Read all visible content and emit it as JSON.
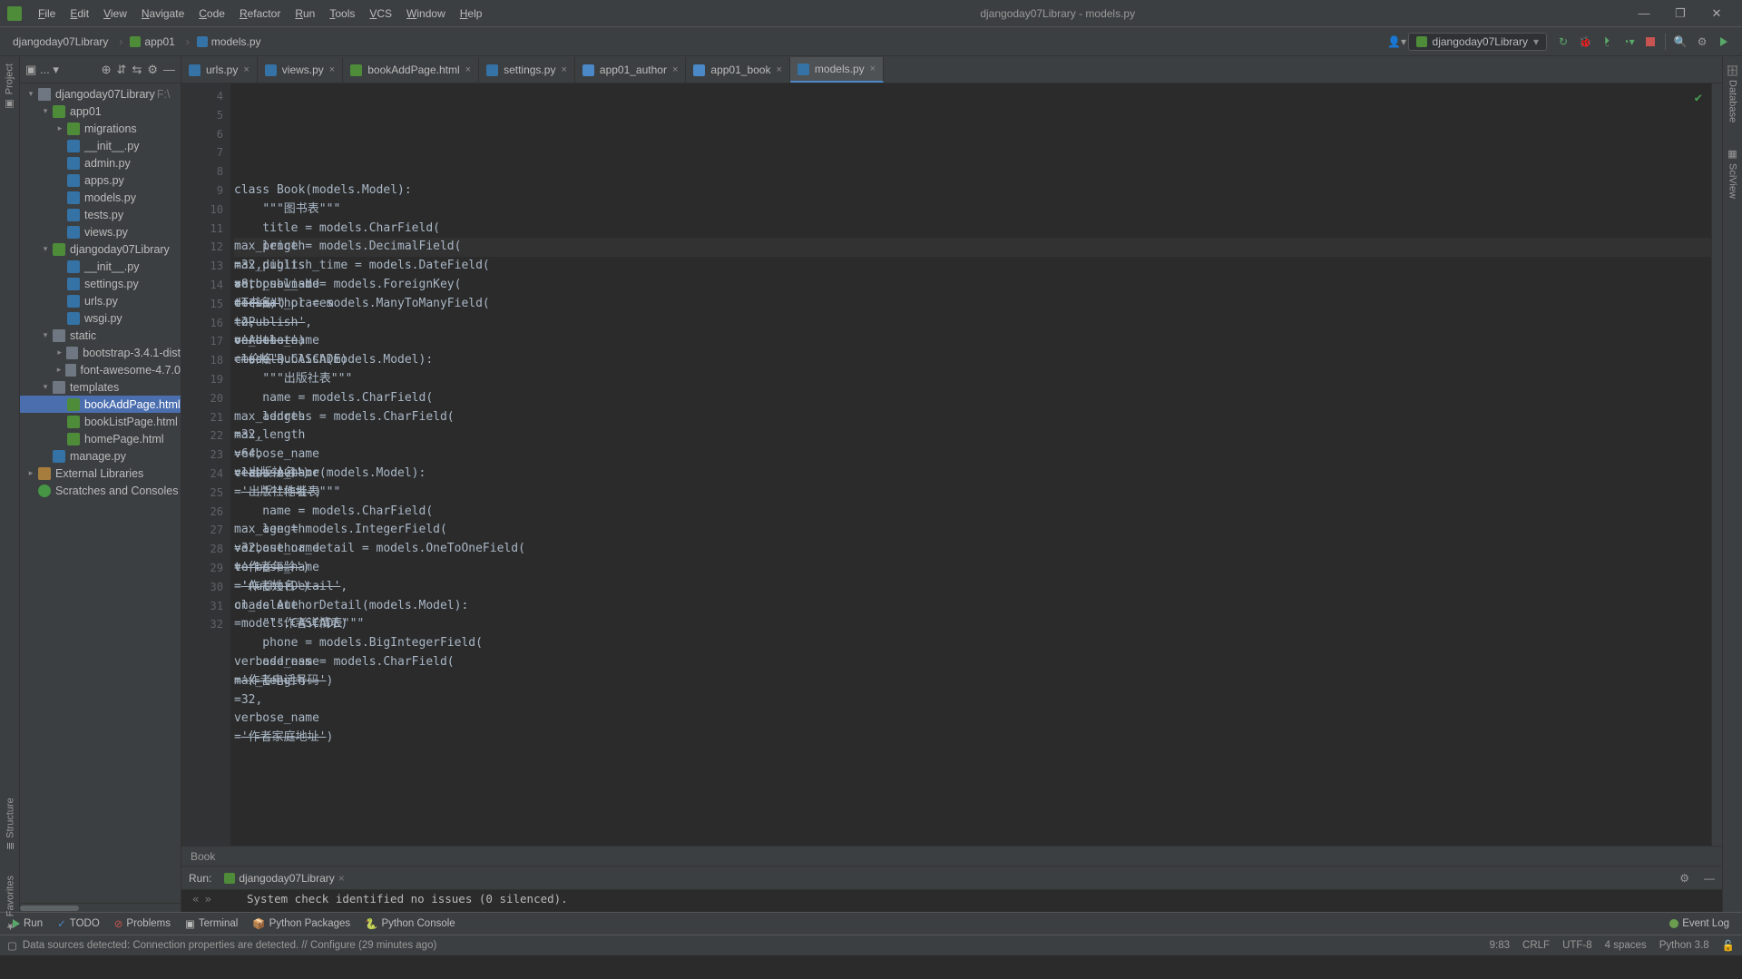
{
  "window": {
    "title": "djangoday07Library - models.py"
  },
  "menu": [
    "File",
    "Edit",
    "View",
    "Navigate",
    "Code",
    "Refactor",
    "Run",
    "Tools",
    "VCS",
    "Window",
    "Help"
  ],
  "breadcrumbs": [
    "djangoday07Library",
    "app01",
    "models.py"
  ],
  "runconfig": "djangoday07Library",
  "left_tabs": [
    "Project",
    "Structure",
    "Favorites"
  ],
  "right_tabs": [
    "Database",
    "SciView"
  ],
  "project_tree": [
    {
      "d": 0,
      "tw": "▾",
      "ic": "folder",
      "label": "djangoday07Library",
      "extra": "F:\\"
    },
    {
      "d": 1,
      "tw": "▾",
      "ic": "dj",
      "label": "app01"
    },
    {
      "d": 2,
      "tw": "▸",
      "ic": "dj",
      "label": "migrations"
    },
    {
      "d": 2,
      "tw": "",
      "ic": "py",
      "label": "__init__.py"
    },
    {
      "d": 2,
      "tw": "",
      "ic": "py",
      "label": "admin.py"
    },
    {
      "d": 2,
      "tw": "",
      "ic": "py",
      "label": "apps.py"
    },
    {
      "d": 2,
      "tw": "",
      "ic": "py",
      "label": "models.py"
    },
    {
      "d": 2,
      "tw": "",
      "ic": "py",
      "label": "tests.py"
    },
    {
      "d": 2,
      "tw": "",
      "ic": "py",
      "label": "views.py"
    },
    {
      "d": 1,
      "tw": "▾",
      "ic": "dj",
      "label": "djangoday07Library"
    },
    {
      "d": 2,
      "tw": "",
      "ic": "py",
      "label": "__init__.py"
    },
    {
      "d": 2,
      "tw": "",
      "ic": "py",
      "label": "settings.py"
    },
    {
      "d": 2,
      "tw": "",
      "ic": "py",
      "label": "urls.py"
    },
    {
      "d": 2,
      "tw": "",
      "ic": "py",
      "label": "wsgi.py"
    },
    {
      "d": 1,
      "tw": "▾",
      "ic": "folder",
      "label": "static"
    },
    {
      "d": 2,
      "tw": "▸",
      "ic": "folder",
      "label": "bootstrap-3.4.1-dist"
    },
    {
      "d": 2,
      "tw": "▸",
      "ic": "folder",
      "label": "font-awesome-4.7.0"
    },
    {
      "d": 1,
      "tw": "▾",
      "ic": "folder",
      "label": "templates"
    },
    {
      "d": 2,
      "tw": "",
      "ic": "html",
      "label": "bookAddPage.html",
      "sel": true
    },
    {
      "d": 2,
      "tw": "",
      "ic": "html",
      "label": "bookListPage.html"
    },
    {
      "d": 2,
      "tw": "",
      "ic": "html",
      "label": "homePage.html"
    },
    {
      "d": 1,
      "tw": "",
      "ic": "py",
      "label": "manage.py"
    },
    {
      "d": 0,
      "tw": "▸",
      "ic": "libs",
      "label": "External Libraries"
    },
    {
      "d": 0,
      "tw": "",
      "ic": "db",
      "label": "Scratches and Consoles"
    }
  ],
  "tabs": [
    {
      "ic": "#3572a5",
      "label": "urls.py"
    },
    {
      "ic": "#3572a5",
      "label": "views.py"
    },
    {
      "ic": "#4e8c3a",
      "label": "bookAddPage.html"
    },
    {
      "ic": "#3572a5",
      "label": "settings.py"
    },
    {
      "ic": "#4a88c7",
      "label": "app01_author"
    },
    {
      "ic": "#4a88c7",
      "label": "app01_book"
    },
    {
      "ic": "#3572a5",
      "label": "models.py",
      "active": true
    }
  ],
  "line_start": 4,
  "code": [
    "",
    "",
    "<k>class </k>Book(models.Model):",
    "    <c>\"\"\"图书表\"\"\"</c>",
    "    title = models.CharField(<p>max_length</p>=<n>32</n>, <p>verbose_name</p>=<s>'书名'</s>)",
    "    price = models.DecimalField(<p>max_digits</p>=<n>8</n>, <p>decimal_places</p>=<n>2</n>, <p>verbose_name</p>=<s>'价格'</s>)",
    "    publish_time = models.DateField(<p>auto_now_add</p>=<k>True</k>)",
    "    publish = models.ForeignKey(<p>to</p>=<s>'Publish'</s>, <p>on_delete</p>=models.CASCADE)",
    "    author = models.ManyToManyField(<p>to</p>=<s>'Author'</s>)",
    "",
    "",
    "<k>class </k>Publish(models.Model):",
    "    <c>\"\"\"出版社表\"\"\"</c>",
    "    name = models.CharField(<p>max_length</p>=<n>32</n>, <p>verbose_name</p>=<s>'出版社名'</s>)",
    "    address = models.CharField(<p>max_length</p>=<n>64</n>, <p>verbose_name</p>=<s>'出版社地址'</s>)",
    "",
    "",
    "<k>class </k>Author(models.Model):",
    "    <c>\"\"\"作者表\"\"\"</c>",
    "    name = models.CharField(<p>max_length</p>=<n>32</n>, <p>verbose_name</p>=<s>'作者姓名'</s>)",
    "    age = models.IntegerField(<p>verbose_name</p>=<s>'作者年龄'</s>)",
    "    author_detail = models.OneToOneField(<p>to</p>=<s>'AuthorDetail'</s>, <p>on_delete</p>=models.CASCADE)",
    "",
    "",
    "<k>class </k>AuthorDetail(models.Model):",
    "    <c>\"\"\"作者详情表\"\"\"</c>",
    "    phone = models.BigIntegerField(<p>verbose_name</p>=<s>'作者电话号码'</s>)",
    "    address = models.CharField(<p>max_length</p>=<n>32</n>, <p>verbose_name</p>=<s>'作者家庭地址'</s>)",
    ""
  ],
  "highlight_line": 9,
  "editor_crumb": "Book",
  "run": {
    "label": "Run:",
    "tab": "djangoday07Library",
    "output": "System check identified no issues (0 silenced)."
  },
  "bottom_tabs": [
    "Run",
    "TODO",
    "Problems",
    "Terminal",
    "Python Packages",
    "Python Console"
  ],
  "event_log": "Event Log",
  "status_left": "Data sources detected: Connection properties are detected. // Configure (29 minutes ago)",
  "status_right": [
    "9:83",
    "CRLF",
    "UTF-8",
    "4 spaces",
    "Python 3.8"
  ]
}
